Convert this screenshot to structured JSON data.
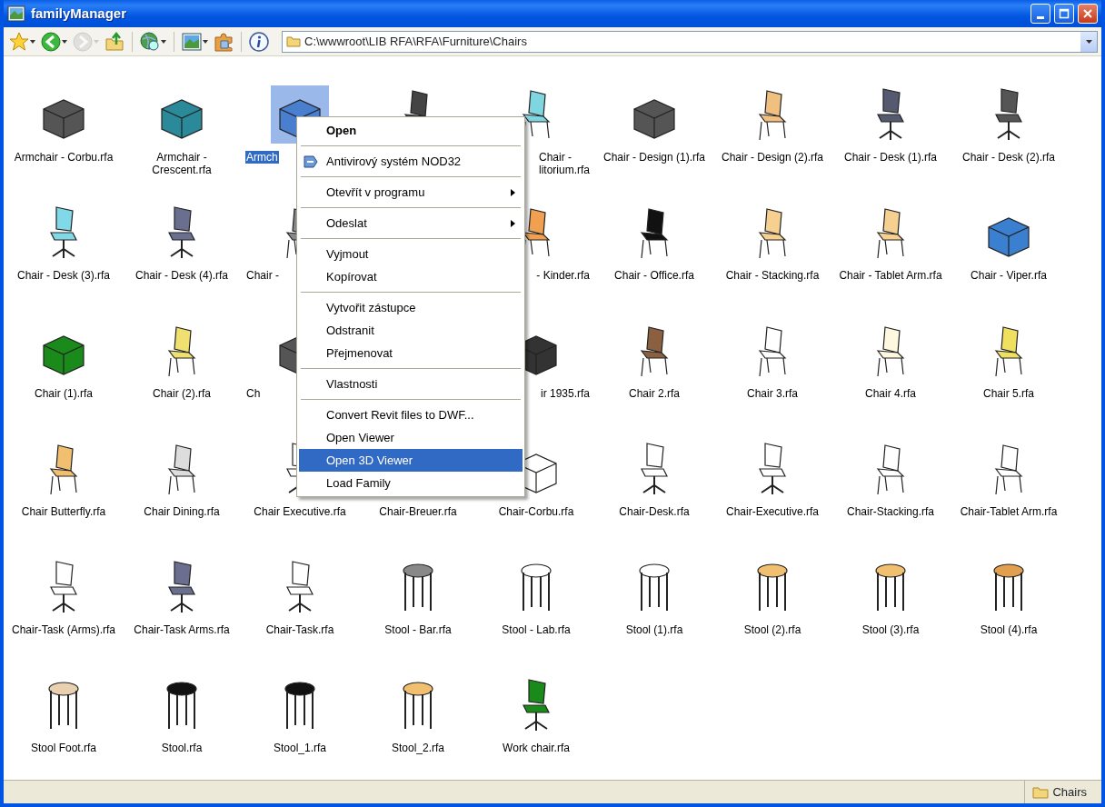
{
  "window": {
    "title": "familyManager"
  },
  "toolbar": [
    {
      "kind": "star",
      "dropdown": true,
      "disabled": false
    },
    {
      "kind": "back",
      "dropdown": true,
      "disabled": false
    },
    {
      "kind": "forward",
      "dropdown": true,
      "disabled": true
    },
    {
      "kind": "up",
      "dropdown": false,
      "disabled": false
    },
    {
      "kind": "separator"
    },
    {
      "kind": "globe",
      "dropdown": true,
      "disabled": false
    },
    {
      "kind": "separator"
    },
    {
      "kind": "picture",
      "dropdown": true,
      "disabled": false
    },
    {
      "kind": "puzzle",
      "dropdown": false,
      "disabled": false
    },
    {
      "kind": "separator"
    },
    {
      "kind": "info",
      "dropdown": false,
      "disabled": false
    }
  ],
  "address": {
    "path": "C:\\wwwroot\\LIB RFA\\RFA\\Furniture\\Chairs"
  },
  "files": [
    {
      "label": "Armchair - Corbu.rfa",
      "kind": "armchair",
      "color": "#555555",
      "selected": false
    },
    {
      "label": "Armchair - Crescent.rfa",
      "kind": "armchair",
      "color": "#2a8a99",
      "selected": false
    },
    {
      "label": "Armch",
      "kind": "armchair",
      "color": "#4a7fd0",
      "selected": true,
      "clipped_right": true
    },
    {
      "kind": "chair",
      "color": "#444444"
    },
    {
      "label": "Chair -\nlitorium.rfa",
      "kind": "chair",
      "color": "#7fd6e0",
      "selected": false,
      "clipped_left": true
    },
    {
      "label": "Chair - Design (1).rfa",
      "kind": "armchair",
      "color": "#555555",
      "selected": false
    },
    {
      "label": "Chair - Design (2).rfa",
      "kind": "chair",
      "color": "#f0c080",
      "selected": false
    },
    {
      "label": "Chair - Desk (1).rfa",
      "kind": "office",
      "color": "#555a70",
      "selected": false
    },
    {
      "label": "Chair - Desk (2).rfa",
      "kind": "office",
      "color": "#555555",
      "selected": false
    },
    {
      "label": "Chair - Desk (3).rfa",
      "kind": "office",
      "color": "#80d8e8",
      "selected": false
    },
    {
      "label": "Chair - Desk (4).rfa",
      "kind": "office",
      "color": "#6a6f90",
      "selected": false
    },
    {
      "label": "Chair -",
      "kind": "chair",
      "color": "#888888",
      "selected": false,
      "clipped_right": true
    },
    {
      "kind": "covered"
    },
    {
      "label": "- Kinder.rfa",
      "kind": "chair",
      "color": "#f0a050",
      "selected": false,
      "clipped_left": true
    },
    {
      "label": "Chair - Office.rfa",
      "kind": "chair",
      "color": "#111111",
      "selected": false
    },
    {
      "label": "Chair - Stacking.rfa",
      "kind": "chair",
      "color": "#f5d090",
      "selected": false
    },
    {
      "label": "Chair - Tablet Arm.rfa",
      "kind": "chair",
      "color": "#f5d090",
      "selected": false
    },
    {
      "label": "Chair - Viper.rfa",
      "kind": "armchair",
      "color": "#3a7fd0",
      "selected": false
    },
    {
      "label": "Chair (1).rfa",
      "kind": "armchair",
      "color": "#1a8a1a",
      "selected": false
    },
    {
      "label": "Chair (2).rfa",
      "kind": "chair",
      "color": "#f0e070",
      "selected": false
    },
    {
      "label": "Ch",
      "kind": "armchair",
      "color": "#555555",
      "selected": false,
      "clipped_right": true
    },
    {
      "kind": "covered"
    },
    {
      "label": "ir 1935.rfa",
      "kind": "armchair",
      "color": "#333333",
      "selected": false,
      "clipped_left": true
    },
    {
      "label": "Chair 2.rfa",
      "kind": "chair",
      "color": "#8a6040",
      "selected": false
    },
    {
      "label": "Chair 3.rfa",
      "kind": "chair",
      "selected": false
    },
    {
      "label": "Chair 4.rfa",
      "kind": "chair",
      "color": "#fff8e0",
      "selected": false
    },
    {
      "label": "Chair 5.rfa",
      "kind": "chair",
      "color": "#f0e060",
      "selected": false
    },
    {
      "label": "Chair Butterfly.rfa",
      "kind": "chair",
      "color": "#f0c070",
      "selected": false
    },
    {
      "label": "Chair Dining.rfa",
      "kind": "chair",
      "color": "#dddddd",
      "selected": false
    },
    {
      "label": "Chair Executive.rfa",
      "kind": "office",
      "selected": false
    },
    {
      "label": "Chair-Breuer.rfa",
      "kind": "covered",
      "selected": false
    },
    {
      "label": "Chair-Corbu.rfa",
      "kind": "armchair",
      "selected": false
    },
    {
      "label": "Chair-Desk.rfa",
      "kind": "office",
      "selected": false
    },
    {
      "label": "Chair-Executive.rfa",
      "kind": "office",
      "selected": false
    },
    {
      "label": "Chair-Stacking.rfa",
      "kind": "chair",
      "selected": false
    },
    {
      "label": "Chair-Tablet Arm.rfa",
      "kind": "chair",
      "selected": false
    },
    {
      "label": "Chair-Task (Arms).rfa",
      "kind": "office",
      "selected": false
    },
    {
      "label": "Chair-Task Arms.rfa",
      "kind": "office",
      "color": "#6a6f90",
      "selected": false
    },
    {
      "label": "Chair-Task.rfa",
      "kind": "office",
      "selected": false
    },
    {
      "label": "Stool - Bar.rfa",
      "kind": "stool",
      "color": "#888888",
      "selected": false
    },
    {
      "label": "Stool - Lab.rfa",
      "kind": "stool",
      "selected": false
    },
    {
      "label": "Stool (1).rfa",
      "kind": "stool",
      "selected": false
    },
    {
      "label": "Stool (2).rfa",
      "kind": "stool",
      "color": "#f0c070",
      "selected": false
    },
    {
      "label": "Stool (3).rfa",
      "kind": "stool",
      "color": "#f0c070",
      "selected": false
    },
    {
      "label": "Stool (4).rfa",
      "kind": "stool",
      "color": "#e0a050",
      "selected": false
    },
    {
      "label": "Stool Foot.rfa",
      "kind": "stool",
      "color": "#e8d0b0",
      "selected": false
    },
    {
      "label": "Stool.rfa",
      "kind": "stool",
      "color": "#111111",
      "selected": false
    },
    {
      "label": "Stool_1.rfa",
      "kind": "stool",
      "color": "#111111",
      "selected": false
    },
    {
      "label": "Stool_2.rfa",
      "kind": "stool",
      "color": "#f0c070",
      "selected": false
    },
    {
      "label": "Work chair.rfa",
      "kind": "office",
      "color": "#1a8a1a",
      "selected": false
    }
  ],
  "context_menu": [
    {
      "kind": "item",
      "label": "Open",
      "bold": true,
      "has_icon": false,
      "submenu": false,
      "selected": false
    },
    {
      "kind": "separator"
    },
    {
      "kind": "item",
      "label": "Antivirový systém NOD32",
      "bold": false,
      "has_icon": true,
      "submenu": false,
      "selected": false
    },
    {
      "kind": "separator"
    },
    {
      "kind": "item",
      "label": "Otevřít v programu",
      "bold": false,
      "has_icon": false,
      "submenu": true,
      "selected": false
    },
    {
      "kind": "separator"
    },
    {
      "kind": "item",
      "label": "Odeslat",
      "bold": false,
      "has_icon": false,
      "submenu": true,
      "selected": false
    },
    {
      "kind": "separator"
    },
    {
      "kind": "item",
      "label": "Vyjmout",
      "bold": false,
      "has_icon": false,
      "submenu": false,
      "selected": false
    },
    {
      "kind": "item",
      "label": "Kopírovat",
      "bold": false,
      "has_icon": false,
      "submenu": false,
      "selected": false
    },
    {
      "kind": "separator"
    },
    {
      "kind": "item",
      "label": "Vytvořit zástupce",
      "bold": false,
      "has_icon": false,
      "submenu": false,
      "selected": false
    },
    {
      "kind": "item",
      "label": "Odstranit",
      "bold": false,
      "has_icon": false,
      "submenu": false,
      "selected": false
    },
    {
      "kind": "item",
      "label": "Přejmenovat",
      "bold": false,
      "has_icon": false,
      "submenu": false,
      "selected": false
    },
    {
      "kind": "separator"
    },
    {
      "kind": "item",
      "label": "Vlastnosti",
      "bold": false,
      "has_icon": false,
      "submenu": false,
      "selected": false
    },
    {
      "kind": "separator"
    },
    {
      "kind": "item",
      "label": "Convert Revit files to DWF...",
      "bold": false,
      "has_icon": false,
      "submenu": false,
      "selected": false
    },
    {
      "kind": "item",
      "label": "Open Viewer",
      "bold": false,
      "has_icon": false,
      "submenu": false,
      "selected": false
    },
    {
      "kind": "item",
      "label": "Open 3D Viewer",
      "bold": false,
      "has_icon": false,
      "submenu": false,
      "selected": true
    },
    {
      "kind": "item",
      "label": "Load Family",
      "bold": false,
      "has_icon": false,
      "submenu": false,
      "selected": false
    }
  ],
  "status_bar": {
    "folder": "Chairs"
  }
}
